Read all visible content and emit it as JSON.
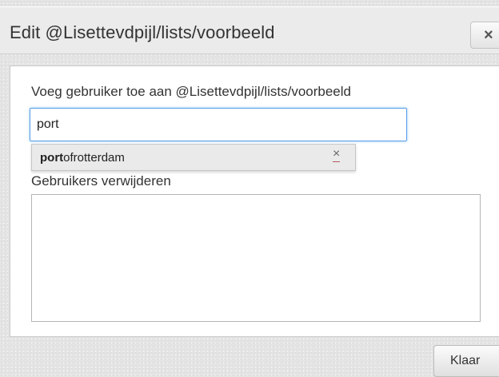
{
  "dialog": {
    "title": "Edit @Lisettevdpijl/lists/voorbeeld",
    "close_label": "×"
  },
  "add_user": {
    "label": "Voeg gebruiker toe aan @Lisettevdpijl/lists/voorbeeld",
    "input_value": "port"
  },
  "suggestions": [
    {
      "match": "port",
      "rest": "ofrotterdam",
      "remove_label": "×"
    }
  ],
  "remove_users": {
    "label": "Gebruikers verwijderen",
    "items": []
  },
  "footer": {
    "done_label": "Klaar"
  }
}
